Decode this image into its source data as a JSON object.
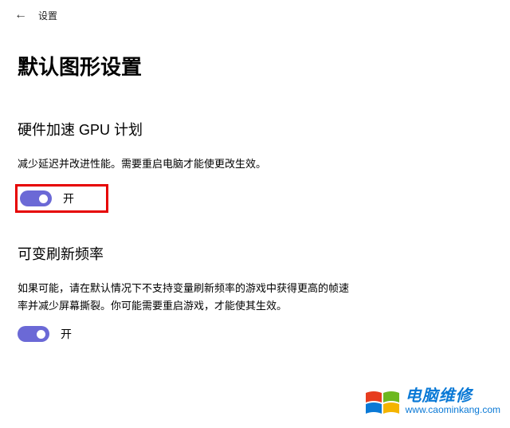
{
  "header": {
    "back_icon": "←",
    "title": "设置"
  },
  "page_title": "默认图形设置",
  "sections": {
    "gpu": {
      "title": "硬件加速 GPU 计划",
      "desc": "减少延迟并改进性能。需要重启电脑才能使更改生效。",
      "toggle_label": "开",
      "toggle_state": "on"
    },
    "vrr": {
      "title": "可变刷新频率",
      "desc": "如果可能，请在默认情况下不支持变量刷新频率的游戏中获得更高的帧速率并减少屏幕撕裂。你可能需要重启游戏，才能使其生效。",
      "toggle_label": "开",
      "toggle_state": "on"
    }
  },
  "watermark": {
    "text_cn": "电脑维修",
    "url": "www.caominkang.com"
  }
}
